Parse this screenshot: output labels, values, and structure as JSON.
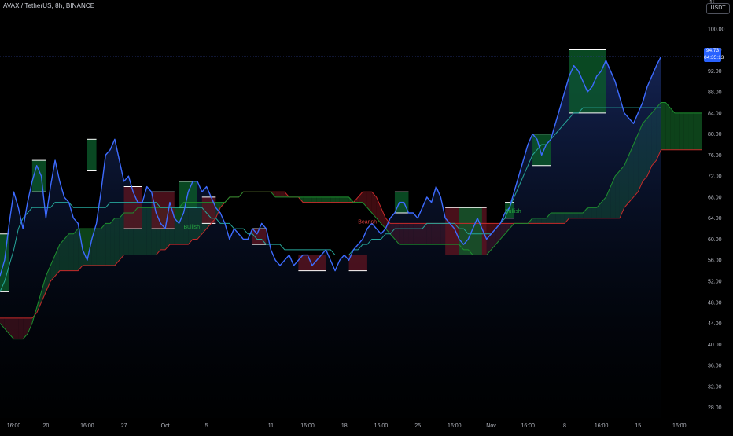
{
  "header": {
    "symbol": "AVAX / TetherUS, 8h, BINANCE",
    "currency": "USDT",
    "scale_mark": "1⁵"
  },
  "colors": {
    "background": "#000000",
    "price_line": "#3d6bff",
    "kijun": "#26a69a",
    "bull_cloud": "#0f4d1e",
    "bear_cloud": "#4a0e14",
    "span_a": "#1e8f2f",
    "span_b": "#c72a2a",
    "up_box": "#0b5a2a",
    "down_box": "#5a1420",
    "axis_text": "#b2b5be",
    "last_price_bg": "#2962ff"
  },
  "last_price": {
    "value": "94.73",
    "countdown": "04:35:13"
  },
  "chart_data": {
    "type": "line",
    "title": "",
    "xlabel": "",
    "ylabel": "",
    "ylim": [
      26,
      104
    ],
    "y_ticks": [
      100,
      96,
      92,
      88,
      84,
      80,
      76,
      72,
      68,
      64,
      60,
      56,
      52,
      48,
      44,
      40,
      36,
      32,
      28
    ],
    "x_ticks": [
      {
        "label": "16:00",
        "bar": 3
      },
      {
        "label": "20",
        "bar": 10
      },
      {
        "label": "16:00",
        "bar": 19
      },
      {
        "label": "27",
        "bar": 27
      },
      {
        "label": "Oct",
        "bar": 36
      },
      {
        "label": "5",
        "bar": 45
      },
      {
        "label": "11",
        "bar": 59
      },
      {
        "label": "16:00",
        "bar": 67
      },
      {
        "label": "18",
        "bar": 75
      },
      {
        "label": "16:00",
        "bar": 83
      },
      {
        "label": "25",
        "bar": 91
      },
      {
        "label": "16:00",
        "bar": 99
      },
      {
        "label": "Nov",
        "bar": 107
      },
      {
        "label": "16:00",
        "bar": 115
      },
      {
        "label": "8",
        "bar": 123
      },
      {
        "label": "16:00",
        "bar": 131
      },
      {
        "label": "15",
        "bar": 139
      },
      {
        "label": "16:00",
        "bar": 148
      }
    ],
    "x_range": [
      0,
      153
    ],
    "series": [
      {
        "name": "",
        "values": [
          53,
          56,
          63,
          69,
          66,
          62,
          67,
          71,
          74,
          72,
          64,
          70,
          75,
          71,
          68,
          67,
          64,
          63,
          58,
          56,
          60,
          63,
          69,
          76,
          77,
          79,
          75,
          71,
          72,
          69,
          67,
          67,
          70,
          69,
          65,
          63,
          62,
          67,
          64,
          63,
          65,
          69,
          71,
          71,
          69,
          70,
          68,
          66,
          65,
          63,
          60,
          62,
          61,
          60,
          60,
          62,
          61,
          63,
          62,
          58,
          56,
          55,
          56,
          57,
          55,
          56,
          57,
          57,
          55,
          56,
          57,
          58,
          56,
          54,
          56,
          57,
          56,
          58,
          59,
          60,
          62,
          63,
          62,
          61,
          62,
          64,
          65,
          67,
          67,
          65,
          65,
          64,
          66,
          68,
          67,
          70,
          68,
          64,
          63,
          62,
          60,
          59,
          60,
          62,
          64,
          62,
          60,
          61,
          62,
          63,
          65,
          66,
          69,
          72,
          75,
          78,
          80,
          79,
          76,
          78,
          79,
          82,
          85,
          88,
          91,
          93,
          92,
          90,
          88,
          89,
          91,
          92,
          94,
          92,
          90,
          87,
          84,
          83,
          82,
          84,
          86,
          89,
          91,
          93,
          94.73
        ]
      },
      {
        "name": "",
        "values": [
          50,
          52,
          55,
          58,
          62,
          64,
          65,
          66,
          66,
          66,
          66,
          66,
          67,
          67,
          67,
          67,
          66,
          66,
          66,
          66,
          66,
          66,
          66,
          66,
          67,
          67,
          67,
          67,
          67,
          67,
          67,
          67,
          67,
          67,
          67,
          66,
          66,
          66,
          66,
          66,
          66,
          66,
          66,
          66,
          66,
          65,
          64,
          64,
          63,
          63,
          63,
          62,
          62,
          62,
          61,
          61,
          60,
          60,
          59,
          59,
          59,
          59,
          58,
          58,
          58,
          58,
          58,
          58,
          58,
          58,
          58,
          58,
          58,
          57,
          57,
          57,
          57,
          58,
          58,
          59,
          59,
          60,
          60,
          60,
          61,
          61,
          62,
          62,
          62,
          62,
          62,
          62,
          62,
          63,
          63,
          63,
          63,
          63,
          63,
          63,
          62,
          62,
          61,
          61,
          61,
          61,
          61,
          61,
          62,
          63,
          64,
          66,
          68,
          70,
          72,
          74,
          76,
          77,
          78,
          78,
          79,
          80,
          81,
          82,
          83,
          84,
          84,
          85,
          85,
          85,
          85,
          85,
          85,
          85,
          85,
          85,
          85,
          85,
          85,
          85,
          85,
          85,
          85,
          85,
          85
        ]
      },
      {
        "name": "",
        "values": [
          44,
          43,
          42,
          41,
          41,
          41,
          42,
          44,
          47,
          50,
          53,
          55,
          57,
          59,
          60,
          61,
          61,
          62,
          62,
          62,
          62,
          62,
          62,
          63,
          63,
          64,
          64,
          65,
          65,
          65,
          66,
          66,
          66,
          66,
          66,
          66,
          66,
          66,
          66,
          66,
          67,
          67,
          67,
          67,
          67,
          67,
          67,
          67,
          67,
          67,
          68,
          68,
          68,
          69,
          69,
          69,
          69,
          69,
          69,
          69,
          68,
          68,
          68,
          68,
          68,
          68,
          68,
          68,
          68,
          68,
          68,
          68,
          68,
          68,
          68,
          68,
          68,
          67,
          67,
          67,
          66,
          65,
          64,
          63,
          62,
          61,
          60,
          59,
          59,
          59,
          59,
          59,
          59,
          59,
          59,
          59,
          59,
          59,
          59,
          59,
          59,
          58,
          58,
          57,
          57,
          57,
          57,
          58,
          59,
          60,
          61,
          62,
          63,
          63,
          63,
          63,
          64,
          64,
          64,
          64,
          65,
          65,
          65,
          65,
          65,
          65,
          65,
          65,
          66,
          66,
          66,
          67,
          68,
          70,
          72,
          73,
          74,
          76,
          78,
          80,
          82,
          83,
          84,
          85,
          86,
          86,
          85,
          84,
          84,
          84,
          84,
          84,
          84,
          84
        ]
      },
      {
        "name": "",
        "values": [
          45,
          45,
          45,
          45,
          45,
          45,
          45,
          45,
          46,
          48,
          50,
          52,
          53,
          54,
          54,
          54,
          54,
          54,
          55,
          55,
          55,
          55,
          55,
          55,
          55,
          55,
          56,
          57,
          57,
          57,
          57,
          57,
          57,
          57,
          57,
          58,
          58,
          59,
          59,
          59,
          59,
          59,
          60,
          60,
          61,
          62,
          63,
          64,
          66,
          67,
          68,
          68,
          68,
          69,
          69,
          69,
          69,
          69,
          69,
          69,
          69,
          69,
          69,
          68,
          68,
          68,
          67,
          67,
          67,
          67,
          67,
          67,
          67,
          67,
          67,
          67,
          67,
          67,
          68,
          69,
          69,
          69,
          68,
          66,
          64,
          63,
          63,
          63,
          63,
          63,
          63,
          63,
          63,
          63,
          63,
          63,
          63,
          63,
          63,
          63,
          63,
          63,
          63,
          63,
          63,
          63,
          63,
          63,
          63,
          63,
          63,
          63,
          63,
          63,
          63,
          63,
          63,
          63,
          63,
          63,
          63,
          63,
          63,
          63,
          64,
          64,
          64,
          64,
          64,
          64,
          64,
          64,
          64,
          64,
          64,
          64,
          66,
          67,
          68,
          69,
          71,
          72,
          74,
          75,
          77,
          77,
          77,
          77,
          77,
          77,
          77,
          77,
          77,
          77
        ]
      }
    ],
    "boxes": [
      {
        "x0": 0,
        "x1": 2,
        "y0": 50,
        "y1": 61,
        "dir": "up"
      },
      {
        "x0": 7,
        "x1": 10,
        "y0": 69,
        "y1": 75,
        "dir": "up"
      },
      {
        "x0": 19,
        "x1": 21,
        "y0": 73,
        "y1": 79,
        "dir": "up"
      },
      {
        "x0": 27,
        "x1": 31,
        "y0": 62,
        "y1": 70,
        "dir": "down"
      },
      {
        "x0": 33,
        "x1": 38,
        "y0": 62,
        "y1": 69,
        "dir": "down"
      },
      {
        "x0": 39,
        "x1": 43,
        "y0": 66,
        "y1": 71,
        "dir": "up"
      },
      {
        "x0": 44,
        "x1": 47,
        "y0": 63,
        "y1": 68,
        "dir": "down"
      },
      {
        "x0": 55,
        "x1": 58,
        "y0": 59,
        "y1": 62,
        "dir": "down"
      },
      {
        "x0": 65,
        "x1": 71,
        "y0": 54,
        "y1": 57,
        "dir": "down"
      },
      {
        "x0": 76,
        "x1": 80,
        "y0": 54,
        "y1": 57,
        "dir": "down"
      },
      {
        "x0": 86,
        "x1": 89,
        "y0": 65,
        "y1": 69,
        "dir": "up"
      },
      {
        "x0": 97,
        "x1": 106,
        "y0": 57,
        "y1": 66,
        "dir": "down"
      },
      {
        "x0": 100,
        "x1": 105,
        "y0": 57,
        "y1": 66,
        "dir": "up"
      },
      {
        "x0": 110,
        "x1": 112,
        "y0": 64,
        "y1": 67,
        "dir": "up"
      },
      {
        "x0": 116,
        "x1": 120,
        "y0": 74,
        "y1": 80,
        "dir": "up"
      },
      {
        "x0": 124,
        "x1": 132,
        "y0": 84,
        "y1": 96,
        "dir": "up"
      }
    ],
    "annotations": [
      {
        "text": "Bullish",
        "bar": 40,
        "y": 62,
        "color": "#26a641"
      },
      {
        "text": "Bearish",
        "bar": 78,
        "y": 63,
        "color": "#e04040"
      },
      {
        "text": "Bullish",
        "bar": 110,
        "y": 65,
        "color": "#26a641"
      }
    ]
  }
}
